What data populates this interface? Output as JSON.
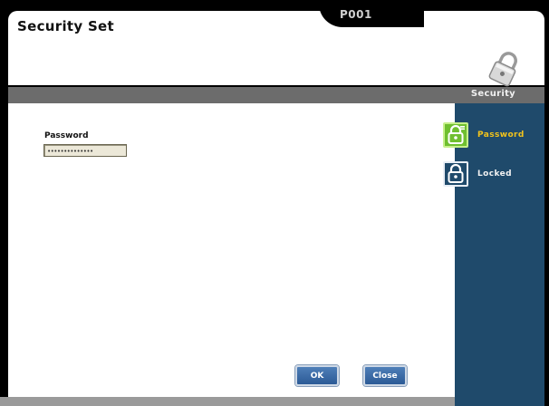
{
  "header": {
    "title": "Security Set",
    "screen_code": "P001"
  },
  "section": {
    "label": "Security"
  },
  "form": {
    "password_label": "Password",
    "password_value": "••••••••••••••"
  },
  "buttons": {
    "ok_label": "OK",
    "close_label": "Close"
  },
  "sidebar": {
    "items": [
      {
        "label": "Password",
        "icon": "padlock-key-icon",
        "active": true
      },
      {
        "label": "Locked",
        "icon": "padlock-icon",
        "active": false
      }
    ]
  },
  "colors": {
    "sidebar_bg": "#1f4a6b",
    "active_label": "#f2c31c",
    "active_icon_bg": "#6fbf2f",
    "section_bar": "#6c6c6c"
  }
}
